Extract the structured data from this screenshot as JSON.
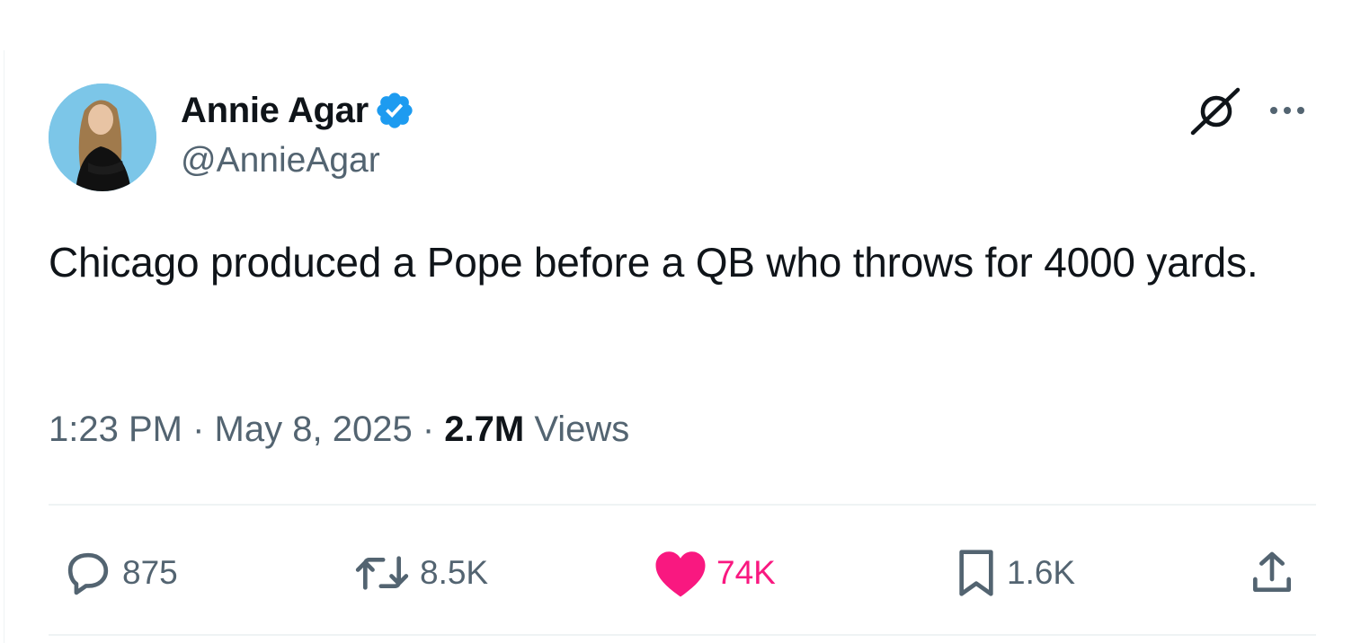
{
  "author": {
    "name": "Annie Agar",
    "handle": "@AnnieAgar",
    "verified": true
  },
  "tweet": {
    "text": "Chicago produced a Pope before a QB who throws for 4000 yards.",
    "time": "1:23 PM",
    "date": "May 8, 2025",
    "separator": "·",
    "views_count": "2.7M",
    "views_label": "Views"
  },
  "actions": {
    "replies": "875",
    "retweets": "8.5K",
    "likes": "74K",
    "bookmarks": "1.6K"
  },
  "icons": {
    "verified": "verified-badge-icon",
    "grok": "grok-icon",
    "more": "more-icon",
    "reply": "reply-icon",
    "retweet": "retweet-icon",
    "like": "heart-icon",
    "bookmark": "bookmark-icon",
    "share": "share-icon"
  },
  "colors": {
    "text": "#0f1419",
    "secondary": "#536471",
    "verified": "#1d9bf0",
    "like": "#f91880",
    "divider": "#eff3f4",
    "avatar_bg": "#7cc6e8"
  }
}
